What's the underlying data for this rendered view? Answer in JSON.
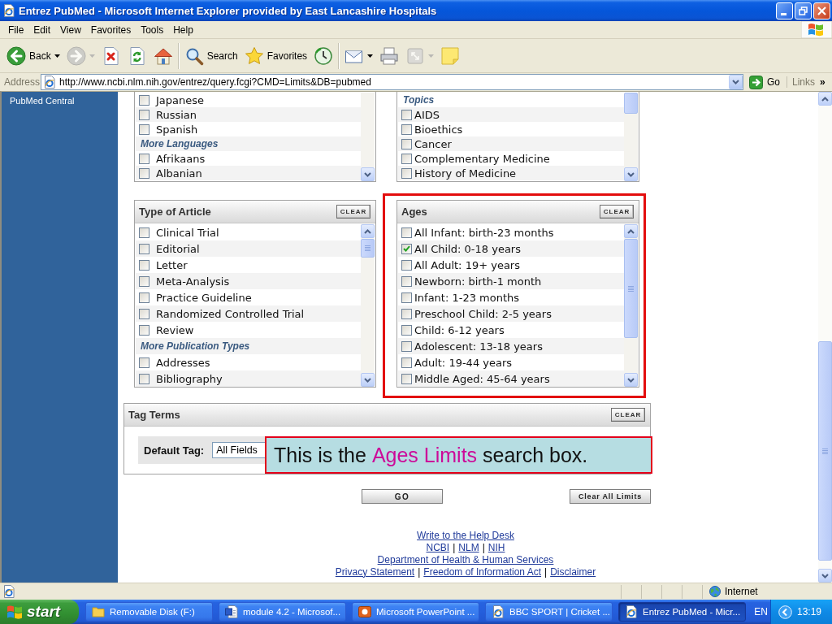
{
  "window": {
    "title": "Entrez PubMed - Microsoft Internet Explorer provided by East Lancashire Hospitals"
  },
  "menu": [
    "File",
    "Edit",
    "View",
    "Favorites",
    "Tools",
    "Help"
  ],
  "toolbar": [
    {
      "buttons": [
        {
          "kind": "back",
          "label": "Back",
          "dropdown": true,
          "disabled": false
        },
        {
          "kind": "forward",
          "dropdown": true,
          "disabled": true
        },
        {
          "kind": "stop",
          "dropdown": false,
          "disabled": false
        },
        {
          "kind": "refresh",
          "dropdown": false,
          "disabled": false
        },
        {
          "kind": "home",
          "dropdown": false,
          "disabled": false
        }
      ]
    },
    {
      "buttons": [
        {
          "kind": "search",
          "label": "Search",
          "dropdown": false,
          "disabled": false
        },
        {
          "kind": "favorites",
          "label": "Favorites",
          "dropdown": false,
          "disabled": false
        },
        {
          "kind": "history",
          "dropdown": false,
          "disabled": false
        }
      ]
    },
    {
      "buttons": [
        {
          "kind": "mail",
          "dropdown": true,
          "disabled": false
        },
        {
          "kind": "print",
          "dropdown": false,
          "disabled": false
        },
        {
          "kind": "resize",
          "dropdown": true,
          "disabled": true
        },
        {
          "kind": "note",
          "dropdown": false,
          "disabled": false
        }
      ]
    }
  ],
  "address_bar": {
    "label": "Address",
    "url": "http://www.ncbi.nlm.nih.gov/entrez/query.fcgi?CMD=Limits&DB=pubmed",
    "go": "Go",
    "links": "Links",
    "more": "»"
  },
  "sidebar": {
    "items": [
      {
        "label": "PubMed Central"
      }
    ]
  },
  "panels": [
    {
      "highlighted": false,
      "rows": [
        {
          "kind": "option",
          "label": "Japanese",
          "checked": false
        },
        {
          "kind": "option",
          "label": "Russian",
          "checked": false
        },
        {
          "kind": "option",
          "label": "Spanish",
          "checked": false
        },
        {
          "kind": "group",
          "label": "More Languages"
        },
        {
          "kind": "option",
          "label": "Afrikaans",
          "checked": false
        },
        {
          "kind": "option",
          "label": "Albanian",
          "checked": false
        }
      ]
    },
    {
      "highlighted": false,
      "rows": [
        {
          "kind": "group",
          "label": "Topics"
        },
        {
          "kind": "option",
          "label": "AIDS",
          "checked": false
        },
        {
          "kind": "option",
          "label": "Bioethics",
          "checked": false
        },
        {
          "kind": "option",
          "label": "Cancer",
          "checked": false
        },
        {
          "kind": "option",
          "label": "Complementary Medicine",
          "checked": false
        },
        {
          "kind": "option",
          "label": "History of Medicine",
          "checked": false
        }
      ]
    },
    {
      "title": "Type of Article",
      "clear": "CLEAR",
      "highlighted": false,
      "rows": [
        {
          "kind": "option",
          "label": "Clinical Trial",
          "checked": false
        },
        {
          "kind": "option",
          "label": "Editorial",
          "checked": false
        },
        {
          "kind": "option",
          "label": "Letter",
          "checked": false
        },
        {
          "kind": "option",
          "label": "Meta-Analysis",
          "checked": false
        },
        {
          "kind": "option",
          "label": "Practice Guideline",
          "checked": false
        },
        {
          "kind": "option",
          "label": "Randomized Controlled Trial",
          "checked": false
        },
        {
          "kind": "option",
          "label": "Review",
          "checked": false
        },
        {
          "kind": "group",
          "label": "More Publication Types"
        },
        {
          "kind": "option",
          "label": "Addresses",
          "checked": false
        },
        {
          "kind": "option",
          "label": "Bibliography",
          "checked": false
        }
      ]
    },
    {
      "title": "Ages",
      "clear": "CLEAR",
      "highlighted": true,
      "rows": [
        {
          "kind": "option",
          "label": "All Infant: birth-23 months",
          "checked": false
        },
        {
          "kind": "option",
          "label": "All Child: 0-18 years",
          "checked": true
        },
        {
          "kind": "option",
          "label": "All Adult: 19+ years",
          "checked": false
        },
        {
          "kind": "option",
          "label": "Newborn: birth-1 month",
          "checked": false
        },
        {
          "kind": "option",
          "label": "Infant: 1-23 months",
          "checked": false
        },
        {
          "kind": "option",
          "label": "Preschool Child: 2-5 years",
          "checked": false
        },
        {
          "kind": "option",
          "label": "Child: 6-12 years",
          "checked": false
        },
        {
          "kind": "option",
          "label": "Adolescent: 13-18 years",
          "checked": false
        },
        {
          "kind": "option",
          "label": "Adult: 19-44 years",
          "checked": false
        },
        {
          "kind": "option",
          "label": "Middle Aged: 45-64 years",
          "checked": false
        }
      ]
    }
  ],
  "tag_terms": {
    "title": "Tag Terms",
    "clear": "CLEAR",
    "field_label": "Default Tag:",
    "field_value": "All Fields"
  },
  "callout": {
    "lead": "This is the",
    "highlight": "Ages Limits",
    "tail": "search box."
  },
  "buttons": [
    {
      "label": "GO"
    },
    {
      "label": "Clear All Limits"
    }
  ],
  "footer": {
    "lines": [
      {
        "items": [
          {
            "kind": "link",
            "label": "Write to the Help Desk"
          }
        ]
      },
      {
        "items": [
          {
            "kind": "link",
            "label": "NCBI"
          },
          {
            "kind": "separator",
            "label": "|"
          },
          {
            "kind": "link",
            "label": "NLM"
          },
          {
            "kind": "separator",
            "label": "|"
          },
          {
            "kind": "link",
            "label": "NIH"
          }
        ]
      },
      {
        "items": [
          {
            "kind": "link",
            "label": "Department of Health & Human Services"
          }
        ]
      },
      {
        "items": [
          {
            "kind": "link",
            "label": "Privacy Statement"
          },
          {
            "kind": "separator",
            "label": "|"
          },
          {
            "kind": "link",
            "label": "Freedom of Information Act"
          },
          {
            "kind": "separator",
            "label": "|"
          },
          {
            "kind": "link",
            "label": "Disclaimer"
          }
        ]
      }
    ]
  },
  "status_bar": {
    "zone": "Internet"
  },
  "taskbar": {
    "start": "start",
    "items": [
      {
        "kind": "folder",
        "label": "Removable Disk (F:)",
        "selected": false
      },
      {
        "kind": "document",
        "label": "module 4.2 - Microsof...",
        "selected": false
      },
      {
        "kind": "presentation",
        "label": "Microsoft PowerPoint ...",
        "selected": false
      },
      {
        "kind": "browser",
        "label": "BBC SPORT | Cricket ...",
        "selected": false
      },
      {
        "kind": "browser",
        "label": "Entrez PubMed - Micr...",
        "selected": true
      }
    ],
    "language": "EN",
    "clock": "13:19"
  }
}
